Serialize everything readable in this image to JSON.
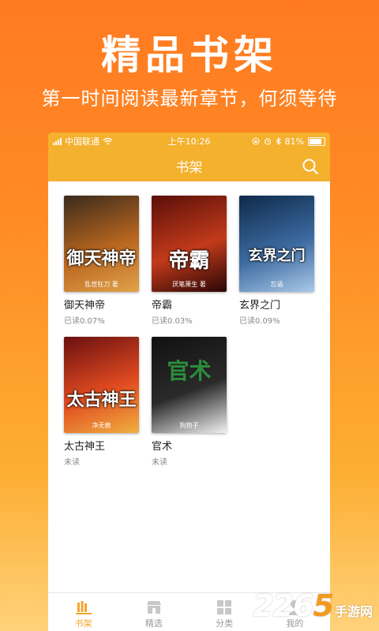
{
  "hero": {
    "title": "精品书架",
    "subtitle": "第一时间阅读最新章节，何须等待"
  },
  "status_bar": {
    "carrier": "中国联通",
    "time": "上午10:26",
    "battery": "81%",
    "battery_level": 0.81
  },
  "nav": {
    "title": "书架",
    "search_icon": "search-icon"
  },
  "books": [
    {
      "title": "御天神帝",
      "progress": "已读0.07%",
      "cover_text": "御天神帝",
      "cover_author": "乱世狂刀 著",
      "cover_colors": [
        "#3a2a1c",
        "#b8661f",
        "#e2a24a"
      ]
    },
    {
      "title": "帝霸",
      "progress": "已读0.03%",
      "cover_text": "帝霸",
      "cover_author": "厌笔萧生 著",
      "cover_colors": [
        "#5a0f0a",
        "#c23a1a",
        "#2a0606"
      ]
    },
    {
      "title": "玄界之门",
      "progress": "已读0.09%",
      "cover_text": "玄界之门",
      "cover_author": "忘语",
      "cover_colors": [
        "#0e2a4a",
        "#3c6aa0",
        "#a9c8e8"
      ]
    },
    {
      "title": "太古神王",
      "progress": "未读",
      "cover_text": "太古神王",
      "cover_author": "净无痕",
      "cover_colors": [
        "#6a1010",
        "#e04a20",
        "#f0b040"
      ]
    },
    {
      "title": "官术",
      "progress": "未读",
      "cover_text": "官术",
      "cover_author": "狗狍子",
      "cover_colors": [
        "#111111",
        "#2a2a2a",
        "#f2f2f2"
      ]
    }
  ],
  "tabs": [
    {
      "label": "书架",
      "icon": "bookshelf-icon",
      "active": true
    },
    {
      "label": "精选",
      "icon": "store-icon",
      "active": false
    },
    {
      "label": "分类",
      "icon": "grid-icon",
      "active": false
    },
    {
      "label": "我的",
      "icon": "person-icon",
      "active": false
    }
  ],
  "watermark": {
    "number_a": "226",
    "number_b": "5",
    "site": "手游网"
  },
  "colors": {
    "accent": "#F4B12E",
    "tab_active": "#F4A62A",
    "background_top": "#FF7A22"
  }
}
